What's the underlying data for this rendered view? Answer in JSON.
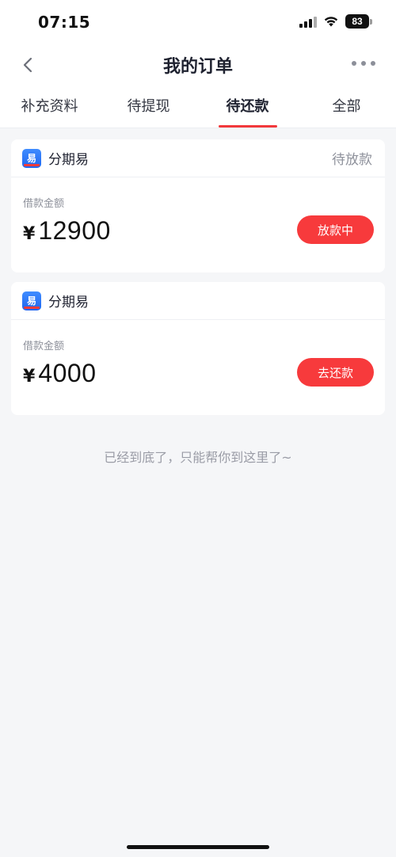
{
  "status_bar": {
    "time": "07:15",
    "battery": "83",
    "icons": [
      "signal-icon",
      "wifi-icon",
      "battery-icon"
    ]
  },
  "header": {
    "title": "我的订单",
    "back_icon": "chevron-left-icon",
    "more_icon": "more-dots-icon"
  },
  "tabs": [
    {
      "label": "补充资料",
      "active": false
    },
    {
      "label": "待提现",
      "active": false
    },
    {
      "label": "待还款",
      "active": true
    },
    {
      "label": "全部",
      "active": false
    }
  ],
  "orders": [
    {
      "app_name": "分期易",
      "status": "待放款",
      "amount_label": "借款金额",
      "currency": "¥",
      "amount": "12900",
      "button_label": "放款中"
    },
    {
      "app_name": "分期易",
      "status": "",
      "amount_label": "借款金额",
      "currency": "¥",
      "amount": "4000",
      "button_label": "去还款"
    }
  ],
  "footer_note": "已经到底了，只能帮你到这里了~",
  "colors": {
    "accent": "#f73a3c",
    "tab_indicator": "#f2383b",
    "background": "#f5f6f8",
    "logo_blue": "#1f66f0"
  }
}
